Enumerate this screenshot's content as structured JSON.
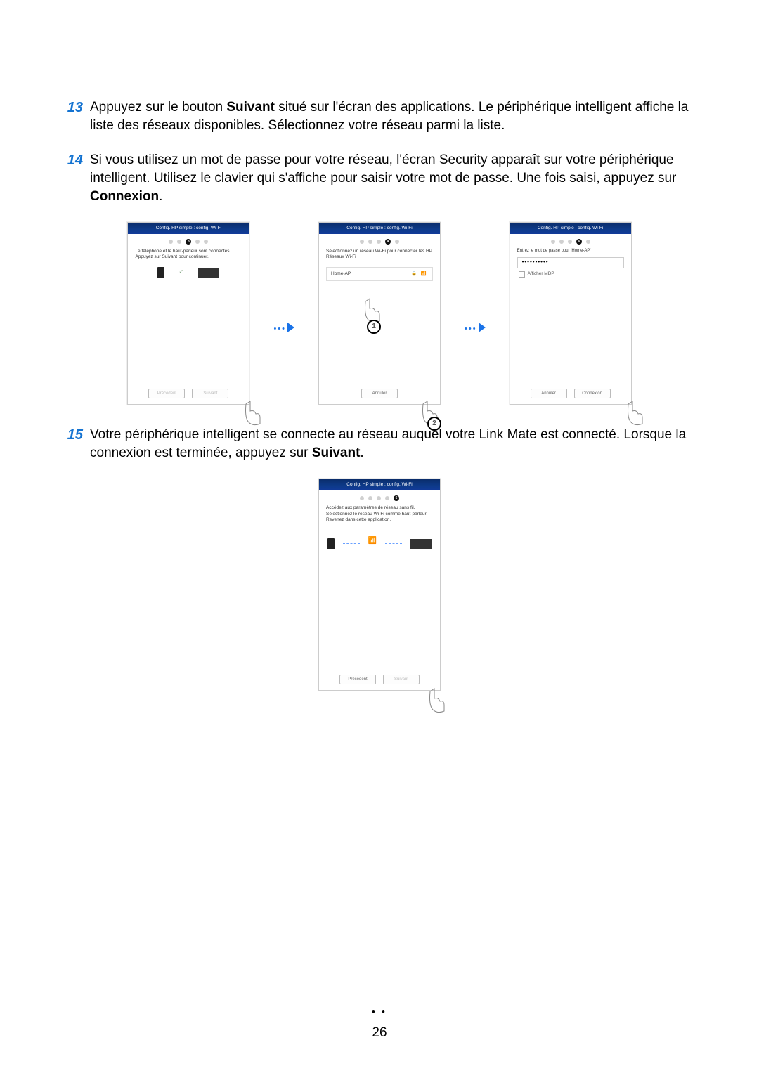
{
  "steps": {
    "s13": {
      "num": "13",
      "text_a": "Appuyez sur le bouton ",
      "bold_a": "Suivant",
      "text_b": " situé sur l'écran des applications. Le périphérique intelligent affiche la liste des réseaux disponibles. Sélectionnez votre réseau parmi la liste."
    },
    "s14": {
      "num": "14",
      "text_a": "Si vous utilisez un mot de passe pour votre réseau, l'écran Security apparaît sur votre périphérique intelligent. Utilisez le clavier qui s'affiche pour saisir votre mot de passe. Une fois saisi, appuyez sur ",
      "bold_a": "Connexion",
      "text_b": "."
    },
    "s15": {
      "num": "15",
      "text_a": "Votre périphérique intelligent se connecte au réseau auquel votre Link Mate est connecté. Lorsque la connexion est terminée, appuyez sur ",
      "bold_a": "Suivant",
      "text_b": "."
    }
  },
  "screen_title": "Config. HP simple : config. Wi-Fi",
  "sc1": {
    "desc": "Le téléphone et le haut-parleur sont connectés.\nAppuyez sur Suivant pour continuer.",
    "active_step": "3",
    "btn_prev": "Précédent",
    "btn_next": "Suivant"
  },
  "sc2": {
    "desc": "Sélectionnez un réseau Wi-Fi pour connecter les HP.\nRéseaux Wi-Fi",
    "active_step": "4",
    "wifi_name": "Home-AP",
    "lock": "🔒",
    "wifi": "📶",
    "btn_cancel": "Annuler"
  },
  "sc3": {
    "prompt": "Entrez le mot de passe pour 'Home-AP'",
    "active_step": "4",
    "masked": "••••••••••",
    "show_pw": "Afficher MDP",
    "btn_cancel": "Annuler",
    "btn_connect": "Connexion"
  },
  "sc4": {
    "desc": "Accédez aux paramètres de réseau sans fil.\nSélectionnez le réseau Wi-Fi comme haut-parleur.\nRevenez dans cette application.",
    "active_step": "5",
    "btn_prev": "Précédent",
    "btn_next": "Suivant"
  },
  "callouts": {
    "one": "1",
    "two": "2"
  },
  "page_number": "26"
}
